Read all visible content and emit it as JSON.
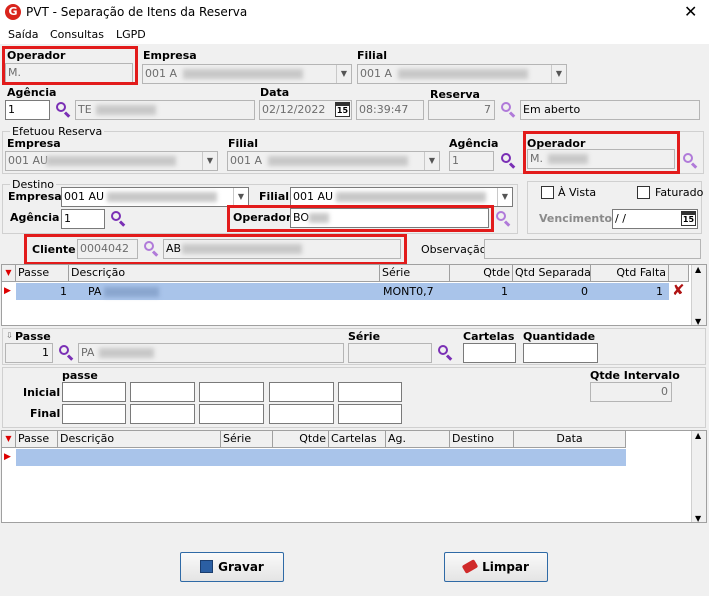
{
  "window": {
    "title": "PVT - Separação de Itens da Reserva",
    "logo_letter": "G",
    "close": "✕"
  },
  "menu": [
    "Saída",
    "Consultas",
    "LGPD"
  ],
  "top": {
    "operador_label": "Operador",
    "operador_value": "M.",
    "empresa_label": "Empresa",
    "empresa_value": "001 A",
    "filial_label": "Filial",
    "filial_value": "001 A",
    "agencia_label": "Agência",
    "agencia_value": "1",
    "agencia_name": "TE",
    "data_label": "Data",
    "data_value": "02/12/2022",
    "time_value": "08:39:47",
    "reserva_label": "Reserva",
    "reserva_value": "7",
    "status_value": "Em aberto"
  },
  "efetuou": {
    "group_label": "Efetuou Reserva",
    "empresa_label": "Empresa",
    "empresa_value": "001 AU",
    "filial_label": "Filial",
    "filial_value": "001 A",
    "agencia_label": "Agência",
    "agencia_value": "1",
    "operador_label": "Operador",
    "operador_value": "M."
  },
  "destino": {
    "group_label": "Destino",
    "empresa_label": "Empresa",
    "empresa_value": "001 AU",
    "filial_label": "Filial",
    "filial_value": "001 AU",
    "agencia_label": "Agência",
    "agencia_value": "1",
    "operador_label": "Operador",
    "operador_value": "BO"
  },
  "pagamento": {
    "avista_label": "À Vista",
    "faturado_label": "Faturado",
    "vencimento_label": "Vencimento",
    "vencimento_value": " /  /"
  },
  "cliente": {
    "label": "Cliente",
    "code": "0004042",
    "name": "AB",
    "obs_label": "Observação"
  },
  "grid1": {
    "headers": [
      "Passe",
      "Descrição",
      "Série",
      "Qtde",
      "Qtd Separada",
      "Qtd Falta"
    ],
    "rows": [
      {
        "passe": "1",
        "descricao": "PA",
        "serie": "MONT0,7",
        "qtde": "1",
        "qtd_separada": "0",
        "qtd_falta": "1"
      }
    ]
  },
  "item": {
    "passe_label": "Passe",
    "passe_value": "1",
    "desc_value": "PA",
    "serie_label": "Série",
    "cartelas_label": "Cartelas",
    "quantidade_label": "Quantidade"
  },
  "intervalo": {
    "passe_label": "passe",
    "inicial_label": "Inicial",
    "final_label": "Final",
    "qtde_label": "Qtde Intervalo",
    "qtde_value": "0"
  },
  "grid2": {
    "headers": [
      "Passe",
      "Descrição",
      "Série",
      "Qtde",
      "Cartelas",
      "Ag.",
      "Destino",
      "Data"
    ]
  },
  "buttons": {
    "gravar": "Gravar",
    "limpar": "Limpar"
  },
  "colors": {
    "highlight": "#e21b1b",
    "selected_row": "#a9c4ea",
    "icon": "#7a2fb5"
  }
}
